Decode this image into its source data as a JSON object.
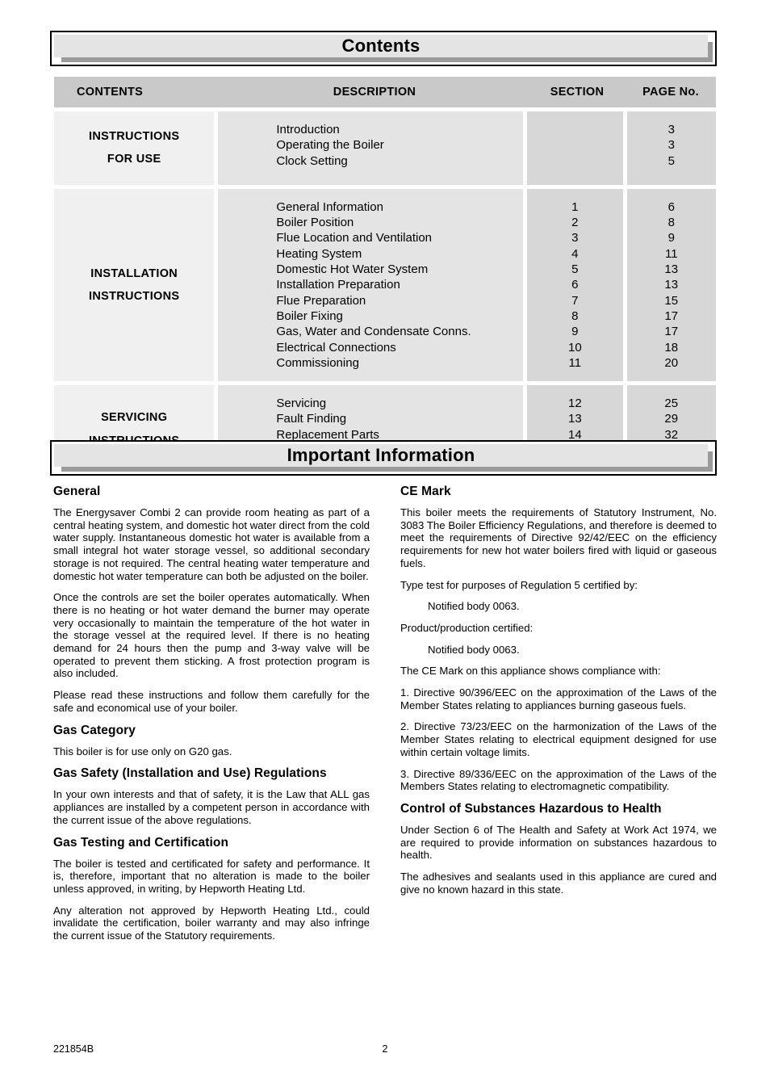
{
  "banners": {
    "contents": "Contents",
    "important": "Important Information"
  },
  "toc": {
    "headers": {
      "contents": "CONTENTS",
      "description": "DESCRIPTION",
      "section": "SECTION",
      "page": "PAGE No."
    },
    "groups": [
      {
        "category_lines": [
          "INSTRUCTIONS",
          "FOR USE"
        ],
        "rows": [
          {
            "description": "Introduction",
            "section": "",
            "page": "3"
          },
          {
            "description": "Operating the Boiler",
            "section": "",
            "page": "3"
          },
          {
            "description": "Clock Setting",
            "section": "",
            "page": "5"
          }
        ]
      },
      {
        "category_lines": [
          "INSTALLATION",
          "INSTRUCTIONS"
        ],
        "rows": [
          {
            "description": "General Information",
            "section": "1",
            "page": "6"
          },
          {
            "description": "Boiler Position",
            "section": "2",
            "page": "8"
          },
          {
            "description": "Flue Location and Ventilation",
            "section": "3",
            "page": "9"
          },
          {
            "description": "Heating System",
            "section": "4",
            "page": "11"
          },
          {
            "description": "Domestic Hot Water System",
            "section": "5",
            "page": "13"
          },
          {
            "description": "Installation Preparation",
            "section": "6",
            "page": "13"
          },
          {
            "description": "Flue Preparation",
            "section": "7",
            "page": "15"
          },
          {
            "description": "Boiler Fixing",
            "section": "8",
            "page": "17"
          },
          {
            "description": "Gas, Water and Condensate Conns.",
            "section": "9",
            "page": "17"
          },
          {
            "description": "Electrical Connections",
            "section": "10",
            "page": "18"
          },
          {
            "description": "Commissioning",
            "section": "11",
            "page": "20"
          }
        ]
      },
      {
        "category_lines": [
          "SERVICING",
          "INSTRUCTIONS"
        ],
        "rows": [
          {
            "description": "Servicing",
            "section": "12",
            "page": "25"
          },
          {
            "description": "Fault Finding",
            "section": "13",
            "page": "29"
          },
          {
            "description": "Replacement Parts",
            "section": "14",
            "page": "32"
          }
        ]
      }
    ]
  },
  "left_column": {
    "general": {
      "title": "General",
      "p1": "The Energysaver Combi 2 can provide room heating as part of a central heating system, and domestic hot water direct from the cold water supply. Instantaneous domestic hot water is available from a small integral hot water storage vessel, so additional secondary storage is not required. The central heating water temperature and domestic hot water temperature can both be adjusted on the boiler.",
      "p2": "Once the controls are set the boiler operates automatically. When there is no heating or hot water demand the burner may operate very occasionally to maintain the temperature of the hot water in the storage vessel at the required level. If there is no heating demand for 24 hours then the pump and 3-way valve will be operated to prevent them sticking. A frost protection program is also included.",
      "p3": "Please read these instructions and follow them carefully for the safe and economical use of your boiler."
    },
    "gas_category": {
      "title": "Gas Category",
      "p1": "This boiler is for use only on G20 gas."
    },
    "gas_safety": {
      "title": "Gas Safety (Installation and Use) Regulations",
      "p1": "In your own interests and that of safety, it is the Law that ALL gas appliances are installed by a competent person in accordance with the current issue of the above regulations."
    },
    "gas_testing": {
      "title": "Gas Testing and Certification",
      "p1": "The boiler is tested and certificated for safety and performance. It is, therefore, important that no alteration is made to the boiler unless approved, in writing, by Hepworth Heating Ltd.",
      "p2": "Any alteration not approved by Hepworth Heating Ltd., could invalidate the certification, boiler warranty and may also infringe the current issue of the Statutory requirements."
    }
  },
  "right_column": {
    "ce_mark": {
      "title": "CE Mark",
      "p1": "This boiler meets the requirements of Statutory Instrument, No. 3083 The Boiler Efficiency Regulations, and therefore is deemed to meet the requirements of Directive 92/42/EEC on the efficiency requirements for new hot water boilers fired with liquid or gaseous fuels.",
      "p2": "Type test for purposes of Regulation 5 certified by:",
      "p3": "Notified body 0063.",
      "p4": "Product/production certified:",
      "p5": "Notified body 0063.",
      "p6": "The CE Mark on this appliance shows compliance with:",
      "p7": "1.   Directive 90/396/EEC on the approximation of the Laws of the Member States relating to appliances burning gaseous fuels.",
      "p8": "2.  Directive 73/23/EEC on the harmonization of the Laws of the Member States relating to electrical equipment designed for use within certain voltage limits.",
      "p9": "3.   Directive 89/336/EEC on the approximation of the Laws of the Members States relating to electromagnetic compatibility."
    },
    "coshh": {
      "title": "Control of Substances Hazardous to Health",
      "p1": "Under Section 6 of The Health and Safety at Work Act 1974, we are required to provide information on substances hazardous to health.",
      "p2": "The adhesives and sealants used in this appliance are cured and give no known hazard in this state."
    }
  },
  "footer": {
    "code": "221854B",
    "page_number": "2"
  }
}
